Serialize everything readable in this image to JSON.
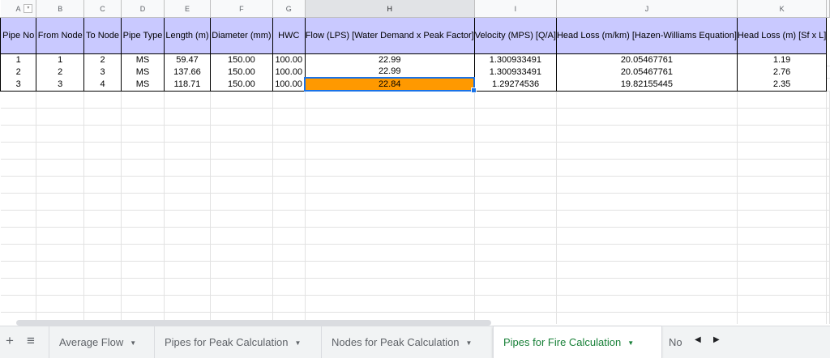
{
  "columns": [
    {
      "letter": "A",
      "width": 81,
      "has_filter": true
    },
    {
      "letter": "B",
      "width": 81
    },
    {
      "letter": "C",
      "width": 80
    },
    {
      "letter": "D",
      "width": 81
    },
    {
      "letter": "E",
      "width": 80
    },
    {
      "letter": "F",
      "width": 99
    },
    {
      "letter": "G",
      "width": 80
    },
    {
      "letter": "H",
      "width": 90,
      "selected": true
    },
    {
      "letter": "I",
      "width": 95
    },
    {
      "letter": "J",
      "width": 140
    },
    {
      "letter": "K",
      "width": 91
    }
  ],
  "headers": [
    "Pipe No",
    "From Node",
    "To Node",
    "Pipe Type",
    "Length (m)",
    "Diameter (mm)",
    "HWC",
    "Flow (LPS) [Water Demand x Peak Factor]",
    "Velocity (MPS) [Q/A]",
    "Head Loss (m/km) [Hazen-Williams Equation]",
    "Head Loss (m) [Sf x L]"
  ],
  "rows": [
    [
      "1",
      "1",
      "2",
      "MS",
      "59.47",
      "150.00",
      "100.00",
      "22.99",
      "1.300933491",
      "20.05467761",
      "1.19"
    ],
    [
      "2",
      "2",
      "3",
      "MS",
      "137.66",
      "150.00",
      "100.00",
      "22.99",
      "1.300933491",
      "20.05467761",
      "2.76"
    ],
    [
      "3",
      "3",
      "4",
      "MS",
      "118.71",
      "150.00",
      "100.00",
      "22.84",
      "1.29274536",
      "19.82155445",
      "2.35"
    ]
  ],
  "selected_cell": {
    "row": 2,
    "col": 7
  },
  "colors": {
    "header_fill": "#c9c9ff",
    "highlight_fill": "#ff9900",
    "selection": "#1a73e8",
    "active_tab": "#188038"
  },
  "tabbar": {
    "add_icon": "+",
    "list_icon": "≡",
    "tabs": [
      {
        "label": "Average Flow"
      },
      {
        "label": "Pipes for Peak Calculation"
      },
      {
        "label": "Nodes for Peak Calculation"
      },
      {
        "label": "Pipes for Fire Calculation",
        "active": true
      },
      {
        "label": "No",
        "truncated": true
      }
    ],
    "prev_icon": "◀",
    "next_icon": "▶"
  }
}
